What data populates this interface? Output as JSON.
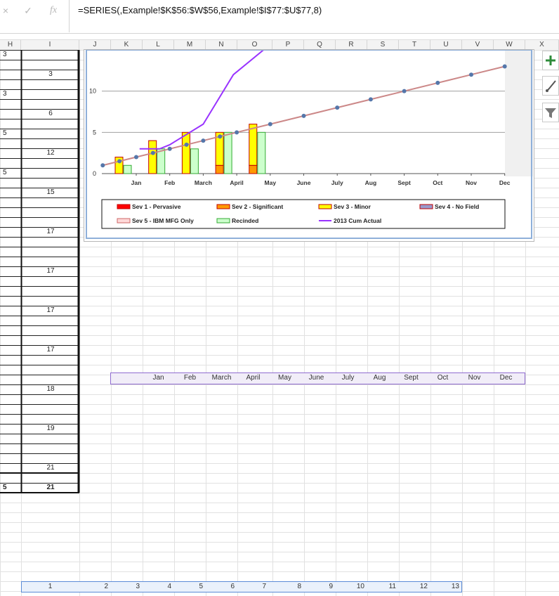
{
  "formula_bar": {
    "cancel_icon": "×",
    "enter_icon": "✓",
    "function_icon": "fx",
    "formula": "=SERIES(,Example!$K$56:$W$56,Example!$I$77:$U$77,8)"
  },
  "columns": [
    "H",
    "I",
    "J",
    "K",
    "L",
    "M",
    "N",
    "O",
    "P",
    "Q",
    "R",
    "S",
    "T",
    "U",
    "V",
    "W",
    "X"
  ],
  "column_h_values": [
    {
      "row": 0,
      "text": "3"
    },
    {
      "row": 4,
      "text": "3"
    },
    {
      "row": 8,
      "text": "5"
    },
    {
      "row": 12,
      "text": "5"
    },
    {
      "row": 44,
      "text": "5",
      "bold": true
    }
  ],
  "column_i_values": [
    {
      "row": 2,
      "text": "3"
    },
    {
      "row": 6,
      "text": "6"
    },
    {
      "row": 10,
      "text": "12"
    },
    {
      "row": 14,
      "text": "15"
    },
    {
      "row": 18,
      "text": "17"
    },
    {
      "row": 22,
      "text": "17"
    },
    {
      "row": 26,
      "text": "17"
    },
    {
      "row": 30,
      "text": "17"
    },
    {
      "row": 34,
      "text": "18"
    },
    {
      "row": 38,
      "text": "19"
    },
    {
      "row": 42,
      "text": "21"
    },
    {
      "row": 44,
      "text": "21",
      "bold": true
    }
  ],
  "month_range": [
    "Jan",
    "Feb",
    "March",
    "April",
    "May",
    "June",
    "July",
    "Aug",
    "Sept",
    "Oct",
    "Nov",
    "Dec"
  ],
  "number_range": [
    "1",
    "2",
    "3",
    "4",
    "5",
    "6",
    "7",
    "8",
    "9",
    "10",
    "11",
    "12",
    "13"
  ],
  "colors": {
    "sev1": "#ff0000",
    "sev2": "#ff9900",
    "sev3": "#ffff00",
    "sev4": "#9999cc",
    "sev5": "#ffd9d9",
    "recinded": "#ccffcc",
    "cum_actual": "#9933ff",
    "target": "#cc8888",
    "target_marker": "#5577aa",
    "selection_purple": "#7e57c2",
    "selection_blue": "#5b8bd6"
  },
  "side_button_icons": [
    "plus-icon",
    "brush-icon",
    "filter-icon"
  ],
  "chart_data": {
    "type": "bar",
    "categories": [
      "Jan",
      "Feb",
      "March",
      "April",
      "May",
      "June",
      "July",
      "Aug",
      "Sept",
      "Oct",
      "Nov",
      "Dec"
    ],
    "ylim": [
      0,
      15
    ],
    "yticks": [
      "0",
      "5",
      "10"
    ],
    "bars": [
      {
        "category": "Jan",
        "sev2": 0,
        "sev3": 2,
        "recinded": 1
      },
      {
        "category": "Feb",
        "sev2": 0,
        "sev3": 4,
        "recinded": 3
      },
      {
        "category": "March",
        "sev2": 0,
        "sev3": 5,
        "recinded": 3
      },
      {
        "category": "April",
        "sev2": 1,
        "sev3": 5,
        "recinded": 5
      },
      {
        "category": "May",
        "sev2": 1,
        "sev3": 6,
        "recinded": 5
      }
    ],
    "series": [
      {
        "name": "Sev 1 - Pervasive",
        "values": []
      },
      {
        "name": "Sev 2 - Significant",
        "values": [
          0,
          0,
          0,
          1,
          1
        ]
      },
      {
        "name": "Sev 3 - Minor",
        "values": [
          2,
          4,
          5,
          6,
          7
        ]
      },
      {
        "name": "Sev 4 - No Field",
        "values": []
      },
      {
        "name": "Sev 5 - IBM MFG Only",
        "values": []
      },
      {
        "name": "Recinded",
        "values": [
          1,
          3,
          3,
          5,
          5
        ]
      },
      {
        "name": "2013 Cum Actual",
        "values": [
          3,
          3,
          3.5,
          6,
          12,
          15
        ]
      }
    ],
    "cum_actual_x": [
      0.1,
      0.7,
      1.0,
      2.0,
      2.9,
      3.8
    ],
    "target_x": [
      -1,
      -0.5,
      0,
      0.5,
      1,
      1.5,
      2,
      2.5,
      3,
      4,
      5,
      6,
      7,
      8,
      9,
      10,
      11
    ],
    "target_y": [
      1,
      1.5,
      2,
      2.5,
      3,
      3.5,
      4,
      4.5,
      5,
      6,
      7,
      8,
      9,
      10,
      11,
      12,
      13
    ],
    "legend": [
      {
        "name": "Sev 1 - Pervasive",
        "key": "sev1",
        "kind": "box"
      },
      {
        "name": "Sev 2 - Significant",
        "key": "sev2",
        "kind": "box"
      },
      {
        "name": "Sev 3 - Minor",
        "key": "sev3",
        "kind": "box"
      },
      {
        "name": "Sev 4 - No Field",
        "key": "sev4",
        "kind": "box"
      },
      {
        "name": "Sev 5 - IBM MFG Only",
        "key": "sev5",
        "kind": "box"
      },
      {
        "name": "Recinded",
        "key": "recinded",
        "kind": "box"
      },
      {
        "name": "2013 Cum Actual",
        "key": "cum_actual",
        "kind": "line"
      }
    ],
    "legend_position": "bottom",
    "grid": true
  }
}
